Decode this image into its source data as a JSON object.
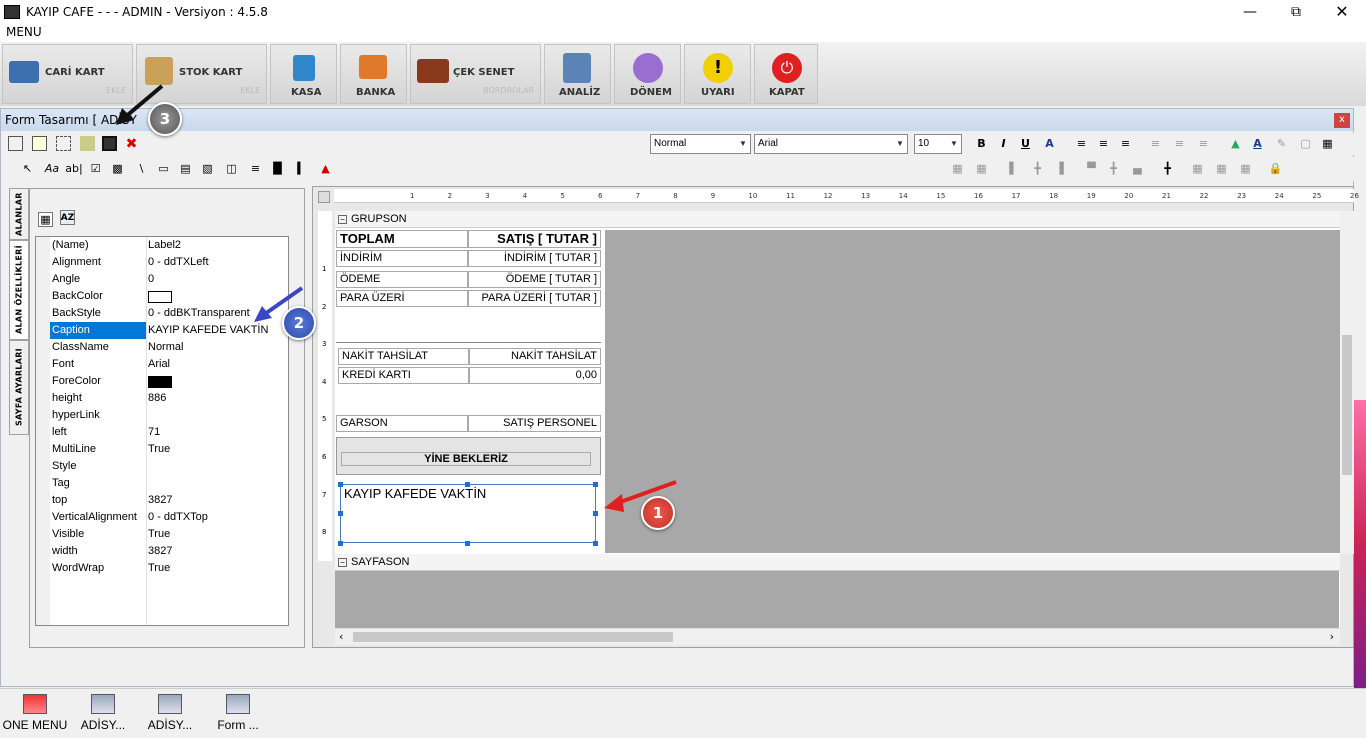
{
  "window": {
    "title": "KAYIP CAFE -  -  - ADMIN -  Versiyon : 4.5.8"
  },
  "menu": {
    "label": "MENU"
  },
  "toolbar": [
    {
      "label": "CARİ KART",
      "sub": "EKLE"
    },
    {
      "label": "STOK KART",
      "sub": "EKLE"
    },
    {
      "label": "KASA",
      "sub": ""
    },
    {
      "label": "BANKA",
      "sub": ""
    },
    {
      "label": "ÇEK SENET",
      "sub": "BORDROLAR"
    },
    {
      "label": "ANALİZ",
      "sub": ""
    },
    {
      "label": "DÖNEM",
      "sub": ""
    },
    {
      "label": "UYARI",
      "sub": ""
    },
    {
      "label": "KAPAT",
      "sub": ""
    }
  ],
  "form": {
    "title": "Form Tasarımı [ ADİSY",
    "close": "x",
    "style_combo": "Normal",
    "font_combo": "Arial",
    "size_combo": "10",
    "format_icons": [
      "B",
      "I",
      "U",
      "A"
    ]
  },
  "tools": {
    "text_tool": "Aa",
    "field_tool": "ab|"
  },
  "sidetabs": [
    "ALANLAR",
    "ALAN ÖZELLİKLERİ",
    "SAYFA AYARLARI"
  ],
  "properties": [
    {
      "name": "(Name)",
      "value": "Label2"
    },
    {
      "name": "Alignment",
      "value": "0 - ddTXLeft"
    },
    {
      "name": "Angle",
      "value": "0"
    },
    {
      "name": "BackColor",
      "value": ""
    },
    {
      "name": "BackStyle",
      "value": "0 - ddBKTransparent"
    },
    {
      "name": "Caption",
      "value": "KAYIP KAFEDE VAKTİN"
    },
    {
      "name": "ClassName",
      "value": "Normal"
    },
    {
      "name": "Font",
      "value": "Arial"
    },
    {
      "name": "ForeColor",
      "value": ""
    },
    {
      "name": "height",
      "value": "886"
    },
    {
      "name": "hyperLink",
      "value": ""
    },
    {
      "name": "left",
      "value": "71"
    },
    {
      "name": "MultiLine",
      "value": "True"
    },
    {
      "name": "Style",
      "value": ""
    },
    {
      "name": "Tag",
      "value": ""
    },
    {
      "name": "top",
      "value": "3827"
    },
    {
      "name": "VerticalAlignment",
      "value": "0 - ddTXTop"
    },
    {
      "name": "Visible",
      "value": "True"
    },
    {
      "name": "width",
      "value": "3827"
    },
    {
      "name": "WordWrap",
      "value": "True"
    }
  ],
  "ruler": {
    "marks": [
      "1",
      "2",
      "3",
      "4",
      "5",
      "6",
      "7",
      "8",
      "9",
      "10",
      "11",
      "12",
      "13",
      "14",
      "15",
      "16",
      "17",
      "18",
      "19",
      "20",
      "21",
      "22",
      "23",
      "24",
      "25",
      "26"
    ],
    "vmarks": [
      "1",
      "2",
      "3",
      "4",
      "5",
      "6",
      "7",
      "8"
    ]
  },
  "report": {
    "grupson": "GRUPSON",
    "sayfason": "SAYFASON",
    "toplam": "TOPLAM",
    "satis_tutar": "SATIŞ [ TUTAR ]",
    "indirim": "İNDİRİM",
    "indirim_tutar": "İNDİRİM [ TUTAR ]",
    "odeme": "ÖDEME",
    "odeme_tutar": "ÖDEME [ TUTAR ]",
    "para_uzeri": "PARA ÜZERİ",
    "para_uzeri_tutar": "PARA ÜZERİ [ TUTAR ]",
    "nakit": "NAKİT TAHSİLAT",
    "nakit_val": "NAKİT TAHSİLAT",
    "kredi": "KREDİ KARTI",
    "kredi_val": "0,00",
    "garson": "GARSON",
    "garson_val": "SATIŞ PERSONEL",
    "yine": "YİNE BEKLERİZ",
    "selected_label": "KAYIP KAFEDE VAKTİN"
  },
  "callouts": [
    "1",
    "2",
    "3"
  ],
  "taskbar": [
    "ONE MENU",
    "ADİSY...",
    "ADİSY...",
    "Form ..."
  ]
}
